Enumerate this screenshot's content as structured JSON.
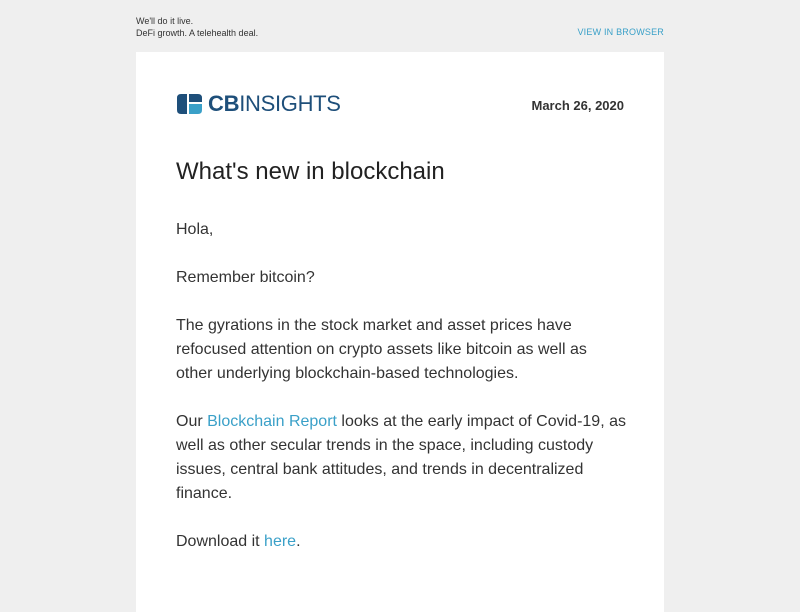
{
  "preheader": {
    "line1": "We'll do it live.",
    "line2": "DeFi growth. A telehealth deal."
  },
  "view_in_browser": "VIEW IN BROWSER",
  "logo": {
    "cb": "CB",
    "insights": "INSIGHTS",
    "icon": "cb-insights-logo-icon",
    "color": "#1e4f7a"
  },
  "date": "March 26, 2020",
  "title": "What's new in blockchain",
  "body": {
    "greeting": "Hola,",
    "p1": "Remember bitcoin?",
    "p2": "The gyrations in the stock market and asset prices have refocused attention on crypto assets like bitcoin as well as other underlying blockchain-based technologies.",
    "p3_pre": "Our ",
    "p3_link": "Blockchain Report",
    "p3_post": " looks at the early impact of Covid-19, as well as other secular trends in the space, including custody issues, central bank attitudes, and trends in decentralized finance.",
    "p4_pre": "Download it ",
    "p4_link": "here",
    "p4_post": "."
  },
  "colors": {
    "background": "#efefef",
    "card": "#ffffff",
    "link": "#3aa0c8",
    "text": "#333333"
  }
}
